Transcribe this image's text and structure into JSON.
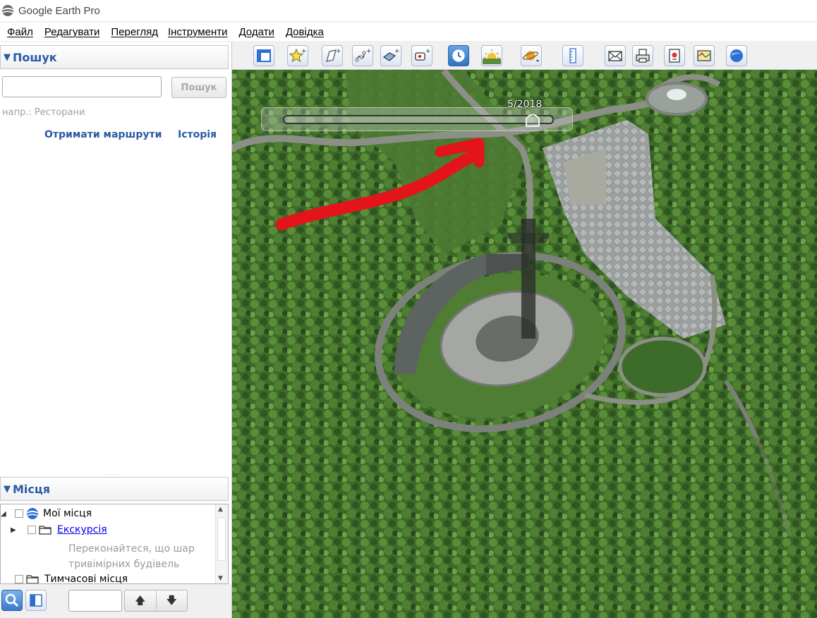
{
  "window": {
    "title": "Google Earth Pro"
  },
  "menu": [
    "Файл",
    "Редагувати",
    "Перегляд",
    "Інструменти",
    "Додати",
    "Довідка"
  ],
  "search": {
    "header": "Пошук",
    "input_value": "",
    "button_label": "Пошук",
    "hint": "напр.: Ресторани",
    "links": [
      "Отримати маршрути",
      "Історія"
    ]
  },
  "places": {
    "header": "Місця",
    "items": [
      {
        "label": "Мої місця",
        "checked": false
      },
      {
        "label": "Екскурсія",
        "checked": false
      },
      {
        "label": "Тимчасові місця",
        "checked": false
      }
    ],
    "tour_description": [
      "Переконайтеся, що шар",
      "тривімірних будівель"
    ]
  },
  "historical_imagery": {
    "date_label": "5/2018",
    "position": 0.95
  },
  "toolbar_icons": [
    "sidebar-toggle-icon",
    "add-placemark-icon",
    "add-polygon-icon",
    "add-path-icon",
    "add-overlay-icon",
    "record-tour-icon",
    "historical-imagery-icon",
    "sunlight-icon",
    "planets-icon",
    "ruler-icon",
    "email-icon",
    "print-icon",
    "save-image-icon",
    "view-in-maps-icon",
    "google-earth-icon"
  ],
  "colors": {
    "accent": "#2b5aa3",
    "annotation_arrow": "#e3141a"
  }
}
